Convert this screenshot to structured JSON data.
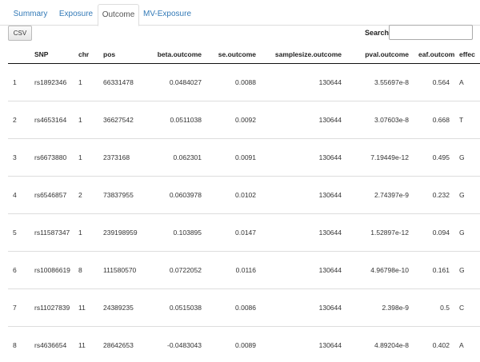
{
  "tabs": [
    {
      "label": "Summary",
      "active": false
    },
    {
      "label": "Exposure",
      "active": false
    },
    {
      "label": "Outcome",
      "active": true
    },
    {
      "label": "MV-Exposure",
      "active": false
    }
  ],
  "toolbar": {
    "csv_label": "CSV"
  },
  "search": {
    "label": "Search:",
    "value": ""
  },
  "table": {
    "columns": [
      "",
      "SNP",
      "chr",
      "pos",
      "beta.outcome",
      "se.outcome",
      "samplesize.outcome",
      "pval.outcome",
      "eaf.outcome",
      "effec"
    ],
    "rows": [
      [
        "1",
        "rs1892346",
        "1",
        "66331478",
        "0.0484027",
        "0.0088",
        "130644",
        "3.55697e-8",
        "0.564",
        "A"
      ],
      [
        "2",
        "rs4653164",
        "1",
        "36627542",
        "0.0511038",
        "0.0092",
        "130644",
        "3.07603e-8",
        "0.668",
        "T"
      ],
      [
        "3",
        "rs6673880",
        "1",
        "2373168",
        "0.062301",
        "0.0091",
        "130644",
        "7.19449e-12",
        "0.495",
        "G"
      ],
      [
        "4",
        "rs6546857",
        "2",
        "73837955",
        "0.0603978",
        "0.0102",
        "130644",
        "2.74397e-9",
        "0.232",
        "G"
      ],
      [
        "5",
        "rs11587347",
        "1",
        "239198959",
        "0.103895",
        "0.0147",
        "130644",
        "1.52897e-12",
        "0.094",
        "G"
      ],
      [
        "6",
        "rs10086619",
        "8",
        "111580570",
        "0.0722052",
        "0.0116",
        "130644",
        "4.96798e-10",
        "0.161",
        "G"
      ],
      [
        "7",
        "rs11027839",
        "11",
        "24389235",
        "0.0515038",
        "0.0086",
        "130644",
        "2.398e-9",
        "0.5",
        "C"
      ],
      [
        "8",
        "rs4636654",
        "11",
        "28642653",
        "-0.0483043",
        "0.0089",
        "130644",
        "4.89204e-8",
        "0.402",
        "A"
      ]
    ]
  }
}
